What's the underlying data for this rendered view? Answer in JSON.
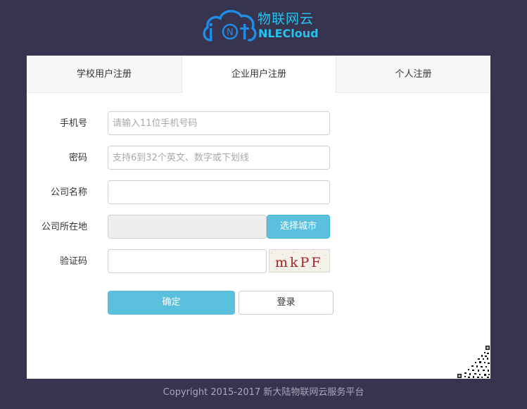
{
  "brand": {
    "name_cn": "物联网云",
    "name_en": "NLECloud",
    "accent_color": "#27c2ec"
  },
  "tabs": [
    {
      "label": "学校用户注册",
      "active": false
    },
    {
      "label": "企业用户注册",
      "active": true
    },
    {
      "label": "个人注册",
      "active": false
    }
  ],
  "form": {
    "phone": {
      "label": "手机号",
      "placeholder": "请输入11位手机号码",
      "value": ""
    },
    "password": {
      "label": "密码",
      "placeholder": "支持6到32个英文、数字或下划线",
      "value": ""
    },
    "company_name": {
      "label": "公司名称",
      "placeholder": "",
      "value": ""
    },
    "company_location": {
      "label": "公司所在地",
      "value": "",
      "select_city_label": "选择城市"
    },
    "captcha": {
      "label": "验证码",
      "value": "",
      "image_text": "mkPF"
    },
    "confirm_label": "确定",
    "login_label": "登录"
  },
  "icons": {
    "logo": "cloud-iot-logo-icon",
    "qr": "qr-code-icon"
  },
  "colors": {
    "background": "#373450",
    "button_primary": "#5bc0de"
  },
  "footer": {
    "copyright": "Copyright 2015-2017 新大陆物联网云服务平台"
  }
}
